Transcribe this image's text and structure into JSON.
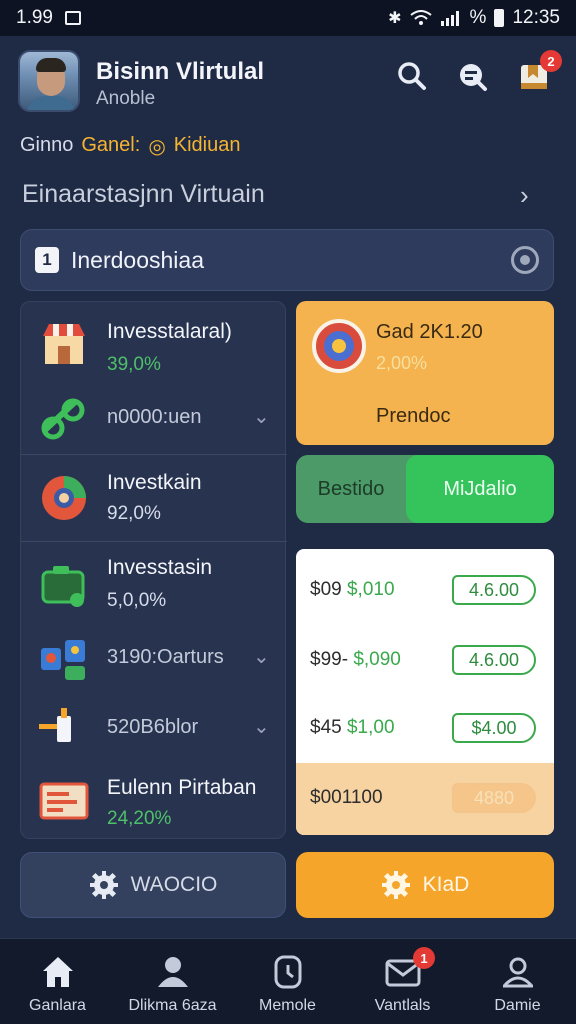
{
  "status_bar": {
    "time_left": "1.99",
    "battery": "%",
    "time_right": "12:35"
  },
  "header": {
    "title": "Bisinn Vlirtulal",
    "subtitle": "Anoble",
    "notification_count": "2"
  },
  "game_row": {
    "label": "Ginno",
    "game": "Ganel:",
    "coin_glyph": "◎",
    "currency": "Kidiuan"
  },
  "section": {
    "title": "Einaarstasjnn Virtuain"
  },
  "search": {
    "badge": "1",
    "text": "Inerdooshiaa"
  },
  "left_list": {
    "items": [
      {
        "name": "Invesstalaral)",
        "value": "39,0%"
      },
      {
        "subtext": "n0000:uen"
      },
      {
        "name": "Investkain",
        "value": "92,0%"
      },
      {
        "name": "Invesstasin",
        "value": "5,0,0%"
      },
      {
        "subtext": "3190:Oarturs"
      },
      {
        "subtext": "520B6blor"
      },
      {
        "name": "Eulenn Pirtaban",
        "value": "24,20%"
      }
    ]
  },
  "gold_card": {
    "title": "Gad 2K1.20",
    "value": "2,00%",
    "label": "Prendoc"
  },
  "toggle": {
    "option_off": "Bestido",
    "option_on": "MiJdalio"
  },
  "offers": [
    {
      "price_a": "$09",
      "price_b": "$,010",
      "pill": "4.6.00"
    },
    {
      "price_a": "$99-",
      "price_b": "$,090",
      "pill": "4.6.00"
    },
    {
      "price_a": "$45",
      "price_b": "$1,00",
      "pill": "$4.00"
    },
    {
      "price_a": "$001100",
      "price_b": "",
      "pill": "4880"
    }
  ],
  "buttons": {
    "left": "WAOCIO",
    "right": "KIaD"
  },
  "bottom_nav": [
    {
      "label": "Ganlara",
      "icon": "home-icon"
    },
    {
      "label": "Dlikma 6aza",
      "icon": "user-icon"
    },
    {
      "label": "Memole",
      "icon": "clock-icon"
    },
    {
      "label": "Vantlals",
      "icon": "mail-icon",
      "badge": "1"
    },
    {
      "label": "Damie",
      "icon": "profile-icon"
    }
  ],
  "colors": {
    "background": "#1f2a44",
    "accent_orange": "#f4a52a",
    "accent_green": "#35c35c",
    "badge_red": "#e53935"
  }
}
